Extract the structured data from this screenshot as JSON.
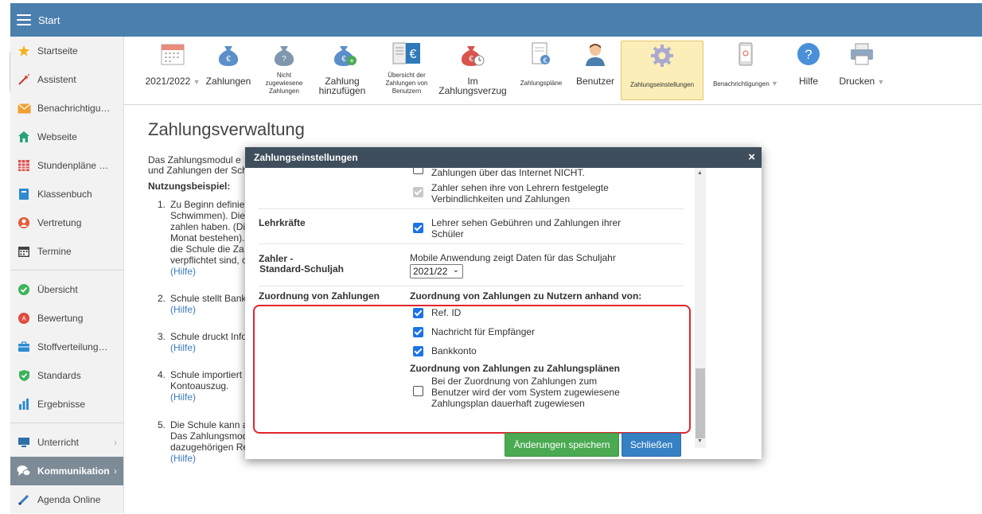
{
  "topbar": {
    "title": "Start"
  },
  "sidebar": {
    "items": [
      {
        "label": "Startseite",
        "icon": "star-icon"
      },
      {
        "label": "Assistent",
        "icon": "wand-icon"
      },
      {
        "label": "Benachrichtigu…",
        "icon": "envelope-icon"
      },
      {
        "label": "Webseite",
        "icon": "house-icon"
      },
      {
        "label": "Stundenpläne …",
        "icon": "timetable-icon"
      },
      {
        "label": "Klassenbuch",
        "icon": "book-icon"
      },
      {
        "label": "Vertretung",
        "icon": "person-icon"
      },
      {
        "label": "Termine",
        "icon": "calendar-icon"
      },
      {
        "label": "Übersicht",
        "icon": "check-circle-icon"
      },
      {
        "label": "Bewertung",
        "icon": "rating-icon"
      },
      {
        "label": "Stoffverteilung…",
        "icon": "briefcase-icon"
      },
      {
        "label": "Standards",
        "icon": "shield-icon"
      },
      {
        "label": "Ergebnisse",
        "icon": "bar-chart-icon"
      },
      {
        "label": "Unterricht",
        "icon": "monitor-icon"
      },
      {
        "label": "Kommunikation",
        "icon": "chat-icon"
      },
      {
        "label": "Agenda Online",
        "icon": "pen-icon"
      }
    ]
  },
  "toolbar": {
    "year": "2021/2022",
    "zahlungen": "Zahlungen",
    "nicht_zugewiesene": "Nicht zugewiesene Zahlungen",
    "zahlung_hinzufuegen": "Zahlung hinzufügen",
    "uebersicht": "Übersicht der Zahlungen von Benutzern",
    "im_zahlungsverzug": "Im Zahlungsverzug",
    "zahlungsplaene": "Zahlungspläne",
    "benutzer": "Benutzer",
    "zahlungseinstellungen": "Zahlungseinstellungen",
    "benachrichtigungen": "Benachrichtigungen",
    "hilfe": "Hilfe",
    "drucken": "Drucken"
  },
  "content": {
    "title": "Zahlungsverwaltung",
    "intro_l1": "Das Zahlungsmodul e",
    "intro_l2": "und Zahlungen der Sch",
    "nutzungsbeispiel": "Nutzungsbeispiel:",
    "item1": [
      "1.",
      "Zu Beginn definie",
      "Schwimmen). Die",
      "zahlen haben. (Di",
      "Monat bestehen).",
      "die Schule die Za",
      "verpflichtet sind, c"
    ],
    "item2": [
      "2.",
      "Schule stellt Bank"
    ],
    "item3": [
      "3.",
      "Schule druckt Info"
    ],
    "item4": [
      "4.",
      "Schule importiert",
      "Kontoauszug."
    ],
    "item5": [
      "5.",
      "Die Schule kann a",
      "Das Zahlungsmod",
      "dazugehörigen Re"
    ],
    "hilfe": "(Hilfe)"
  },
  "modal": {
    "title": "Zahlungseinstellungen",
    "internet_nicht": "Zahlungen über das Internet NICHT.",
    "zahler_sehen_l1": "Zahler sehen ihre von Lehrern festgelegte",
    "zahler_sehen_l2": "Verbindlichkeiten und Zahlungen",
    "lehrkraefte_label": "Lehrkräfte",
    "lehrer_sehen_l1": "Lehrer sehen Gebühren und Zahlungen ihrer",
    "lehrer_sehen_l2": "Schüler",
    "zahler_label_l1": "Zahler -",
    "zahler_label_l2": "Standard-Schuljah",
    "mobile_text": "Mobile Anwendung zeigt Daten für das Schuljahr",
    "schuljahr_value": "2021/22",
    "zuordnung_label": "Zuordnung von Zahlungen",
    "zuordnung_nutzer_heading": "Zuordnung von Zahlungen zu Nutzern anhand von:",
    "ref_id": "Ref. ID",
    "nachricht": "Nachricht für Empfänger",
    "bankkonto": "Bankkonto",
    "zuordnung_plaene_heading": "Zuordnung von Zahlungen zu Zahlungsplänen",
    "plan_text_l1": "Bei der Zuordnung von Zahlungen zum",
    "plan_text_l2": "Benutzer wird der vom System zugewiesene",
    "plan_text_l3": "Zahlungsplan dauerhaft zugewiesen",
    "save_button": "Änderungen speichern",
    "close_button": "Schließen",
    "close_icon": "×"
  },
  "colors": {
    "topbar": "#4a7fae",
    "modal_header": "#3f4e5c",
    "highlight": "#e0262b",
    "save": "#4aaa52",
    "close": "#3680c4"
  }
}
